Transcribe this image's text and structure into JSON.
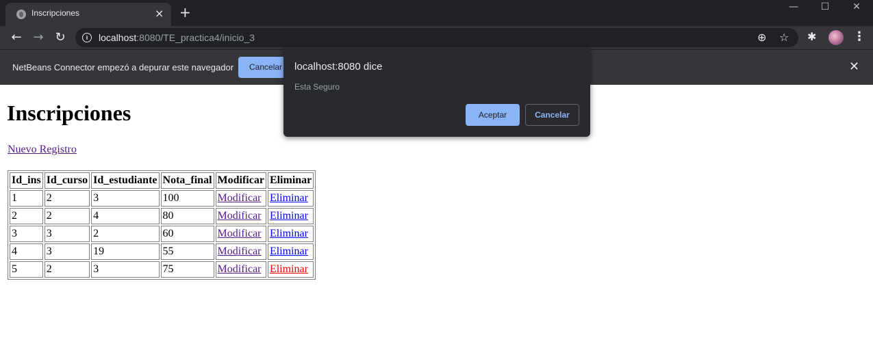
{
  "browser": {
    "tab_title": "Inscripciones",
    "url_host": "localhost",
    "url_path": ":8080/TE_practica4/inicio_3"
  },
  "infobar": {
    "message": "NetBeans Connector empezó a depurar este navegador",
    "cancel_label": "Cancelar"
  },
  "page": {
    "heading": "Inscripciones",
    "new_link": "Nuevo Registro",
    "table": {
      "headers": [
        "Id_ins",
        "Id_curso",
        "Id_estudiante",
        "Nota_final",
        "Modificar",
        "Eliminar"
      ],
      "rows": [
        {
          "id_ins": "1",
          "id_curso": "2",
          "id_estudiante": "3",
          "nota_final": "100",
          "modificar": "Modificar",
          "eliminar": "Eliminar"
        },
        {
          "id_ins": "2",
          "id_curso": "2",
          "id_estudiante": "4",
          "nota_final": "80",
          "modificar": "Modificar",
          "eliminar": "Eliminar"
        },
        {
          "id_ins": "3",
          "id_curso": "3",
          "id_estudiante": "2",
          "nota_final": "60",
          "modificar": "Modificar",
          "eliminar": "Eliminar"
        },
        {
          "id_ins": "4",
          "id_curso": "3",
          "id_estudiante": "19",
          "nota_final": "55",
          "modificar": "Modificar",
          "eliminar": "Eliminar"
        },
        {
          "id_ins": "5",
          "id_curso": "2",
          "id_estudiante": "3",
          "nota_final": "75",
          "modificar": "Modificar",
          "eliminar": "Eliminar"
        }
      ]
    }
  },
  "dialog": {
    "title": "localhost:8080 dice",
    "message": "Esta Seguro",
    "ok_label": "Aceptar",
    "cancel_label": "Cancelar"
  },
  "colors": {
    "accent": "#8ab4f8",
    "chrome_dark": "#202124",
    "visited_link": "#551a8b",
    "link": "#0000ee",
    "active_link": "#ee0000"
  }
}
